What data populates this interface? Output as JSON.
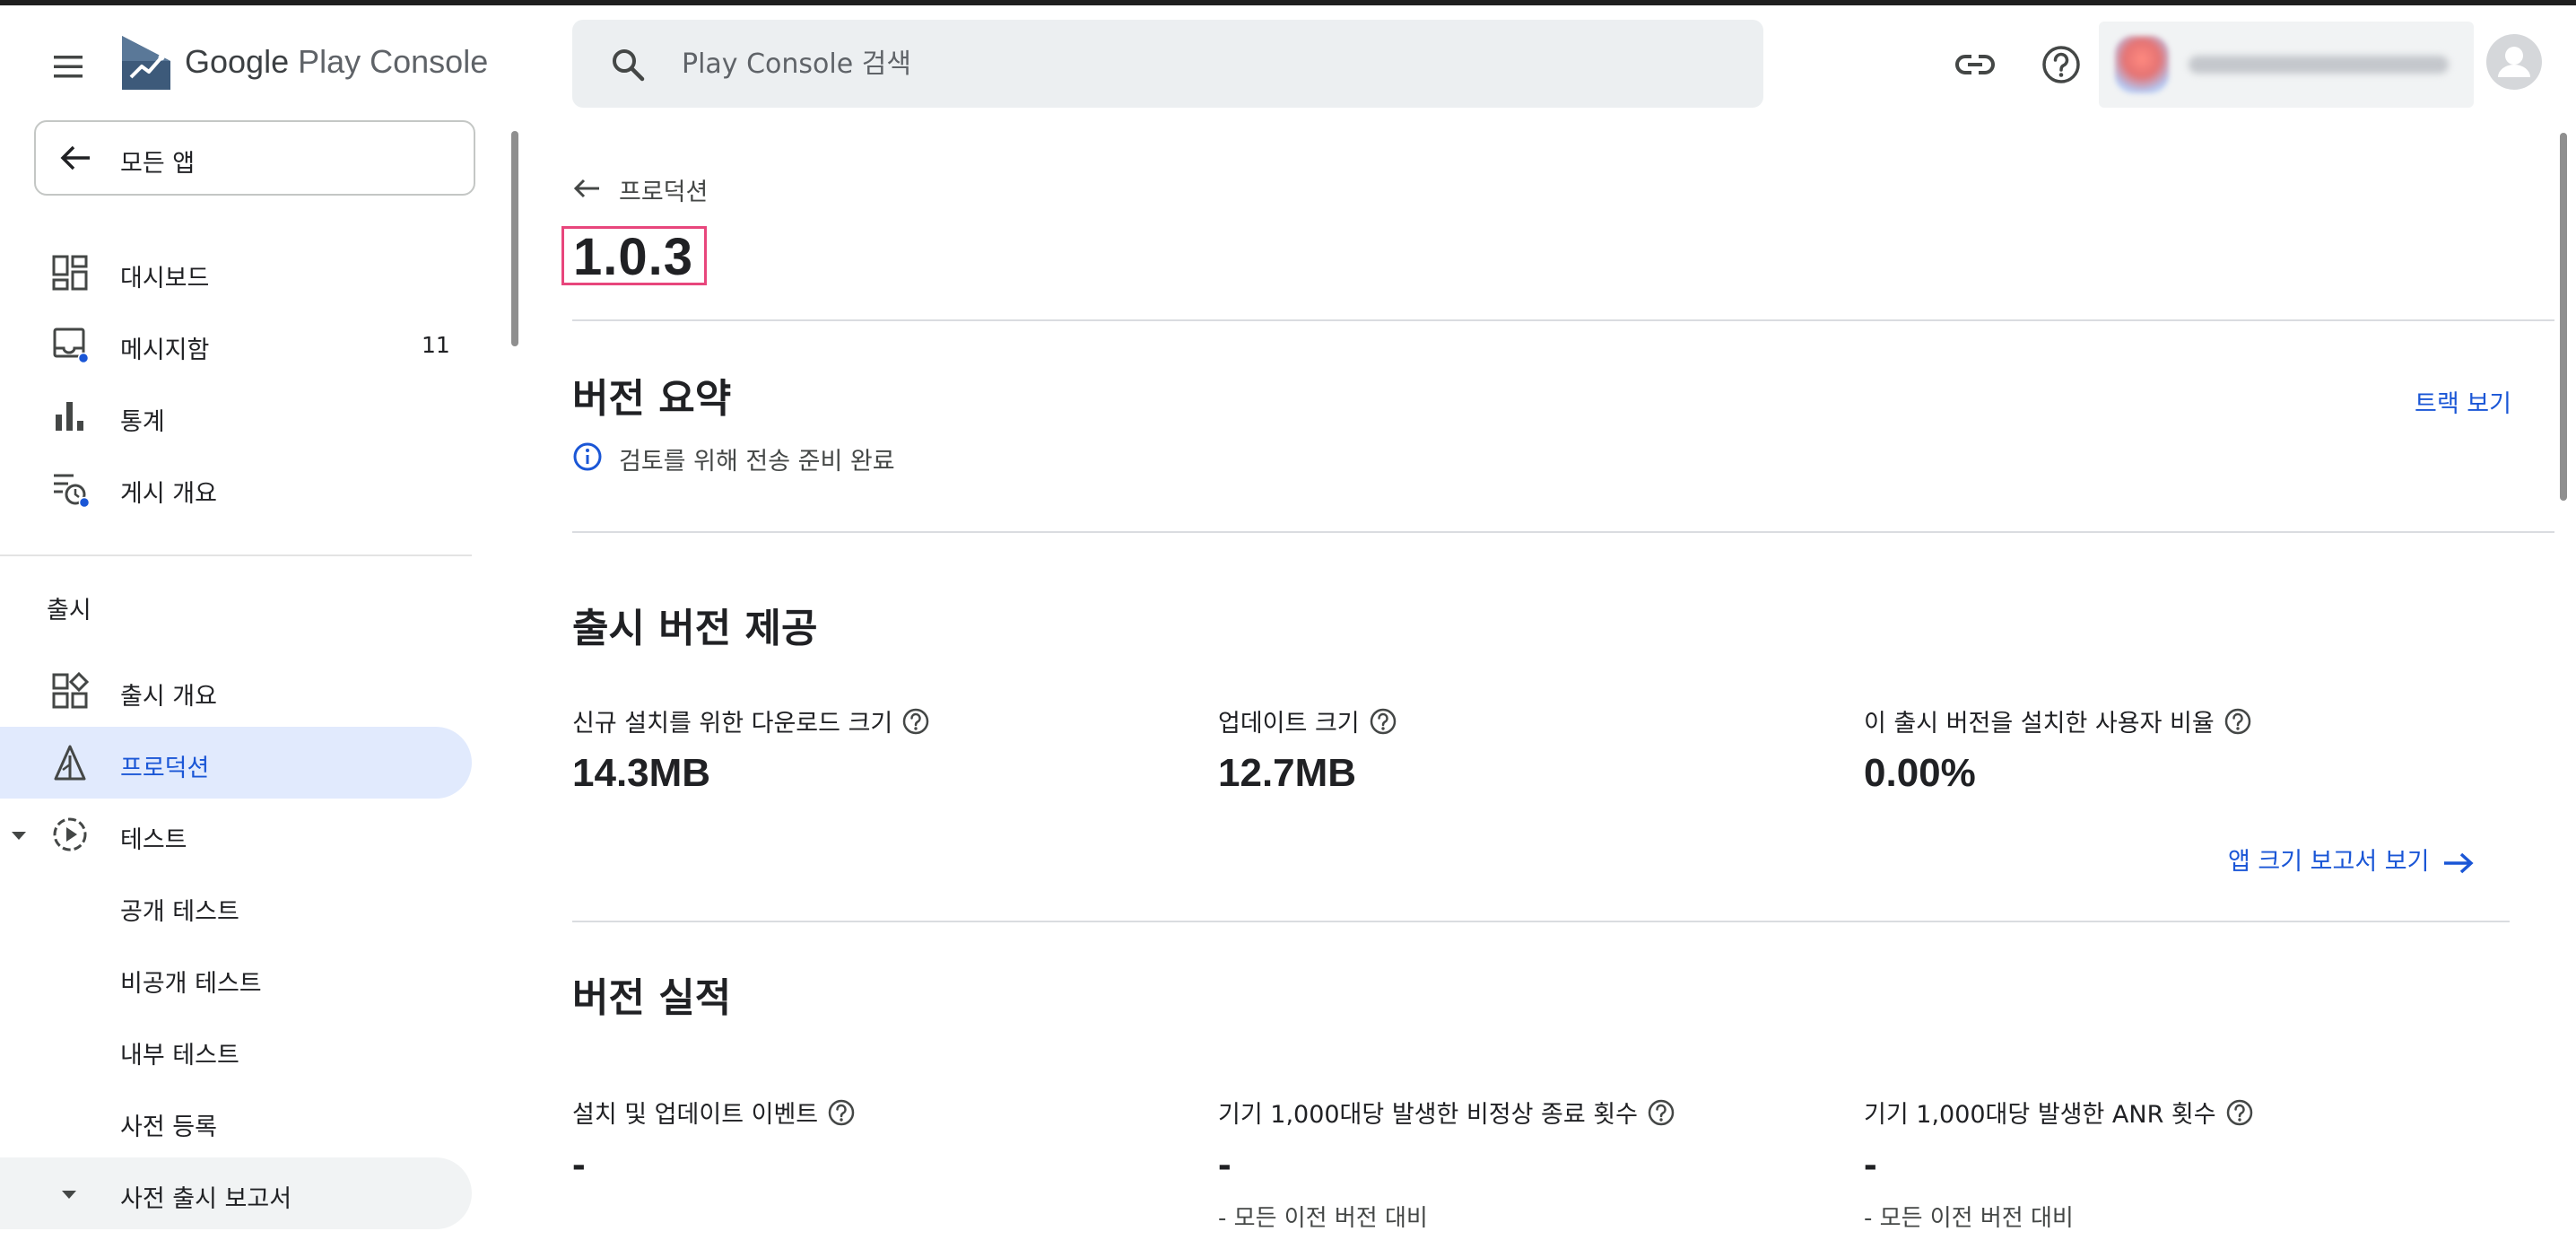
{
  "header": {
    "brand_google": "Google",
    "brand_rest": "Play Console",
    "search_placeholder": "Play Console 검색",
    "icons": [
      "menu-icon",
      "play-console-logo",
      "search-icon",
      "link-icon",
      "help-icon",
      "account-avatar-icon"
    ]
  },
  "sidebar": {
    "all_apps": "모든 앱",
    "items": [
      {
        "label": "대시보드",
        "icon": "dashboard-icon"
      },
      {
        "label": "메시지함",
        "icon": "inbox-icon",
        "count": "11"
      },
      {
        "label": "통계",
        "icon": "bar-chart-icon"
      },
      {
        "label": "게시 개요",
        "icon": "publishing-overview-icon"
      }
    ],
    "release_section": "출시",
    "release_items": [
      {
        "label": "출시 개요",
        "icon": "release-overview-icon"
      },
      {
        "label": "프로덕션",
        "icon": "production-icon",
        "active": true
      },
      {
        "label": "테스트",
        "icon": "testing-icon",
        "expanded": true
      },
      {
        "label": "공개 테스트"
      },
      {
        "label": "비공개 테스트"
      },
      {
        "label": "내부 테스트"
      },
      {
        "label": "사전 등록"
      },
      {
        "label": "사전 출시 보고서",
        "expanded": true
      }
    ]
  },
  "main": {
    "back_label": "프로덕션",
    "version": "1.0.3",
    "summary": {
      "title": "버전 요약",
      "status": "검토를 위해 전송 준비 완료",
      "track_link": "트랙 보기"
    },
    "delivery": {
      "title": "출시 버전 제공",
      "metrics": [
        {
          "label": "신규 설치를 위한 다운로드 크기",
          "value": "14.3MB"
        },
        {
          "label": "업데이트 크기",
          "value": "12.7MB"
        },
        {
          "label": "이 출시 버전을 설치한 사용자 비율",
          "value": "0.00%"
        }
      ],
      "report_link": "앱 크기 보고서 보기"
    },
    "performance": {
      "title": "버전 실적",
      "metrics": [
        {
          "label": "설치 및 업데이트 이벤트",
          "value": "-",
          "sub": ""
        },
        {
          "label": "기기 1,000대당 발생한 비정상 종료 횟수",
          "value": "-",
          "sub": "- 모든 이전 버전 대비"
        },
        {
          "label": "기기 1,000대당 발생한 ANR 횟수",
          "value": "-",
          "sub": "- 모든 이전 버전 대비"
        }
      ]
    }
  },
  "colors": {
    "accent": "#1a56d6",
    "active_bg": "#e1eafd",
    "highlight_border": "#e8467c",
    "badge_dot": "#1a56d6"
  }
}
